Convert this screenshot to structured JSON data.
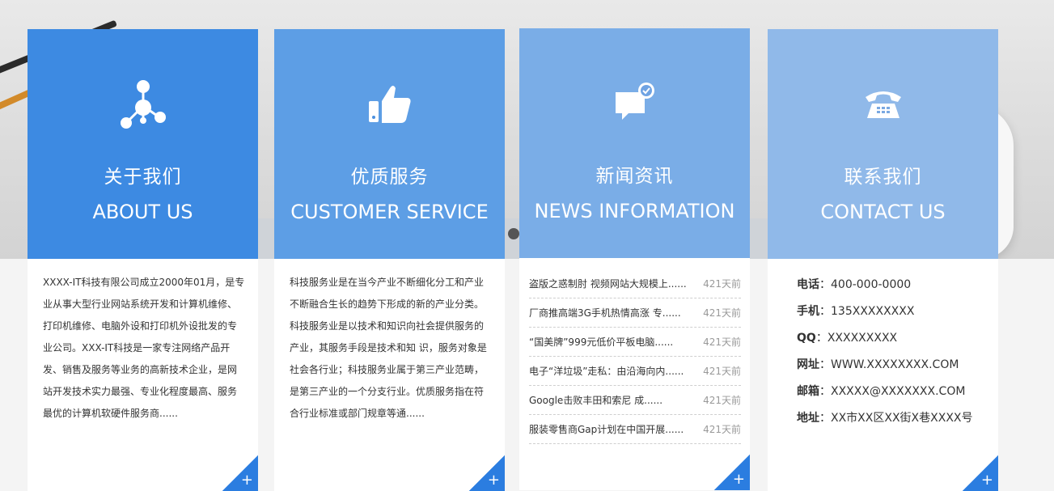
{
  "cards": [
    {
      "icon": "molecule-network-icon",
      "title_cn": "关于我们",
      "title_en": "ABOUT US",
      "text": "XXXX-IT科技有限公司成立2000年01月，是专业从事大型行业网站系统开发和计算机维修、打印机维修、电脑外设和打印机外设批发的专业公司。XXX-IT科技是一家专注网络产品开发、销售及服务等业务的高新技术企业，是网站开发技术实力最强、专业化程度最高、服务最优的计算机软硬件服务商......"
    },
    {
      "icon": "thumbs-up-icon",
      "title_cn": "优质服务",
      "title_en": "CUSTOMER SERVICE",
      "text": " 科技服务业是在当今产业不断细化分工和产业不断融合生长的趋势下形成的新的产业分类。科技服务业是以技术和知识向社会提供服务的产业，其服务手段是技术和知 识，服务对象是社会各行业；科技服务业属于第三产业范畴，是第三产业的一个分支行业。优质服务指在符合行业标准或部门规章等通......"
    },
    {
      "icon": "chat-check-icon",
      "title_cn": "新闻资讯",
      "title_en": "NEWS INFORMATION",
      "news": [
        {
          "title": "盗版之惑制肘 视频网站大规模上......",
          "date": "421天前"
        },
        {
          "title": "厂商推高端3G手机热情高涨 专......",
          "date": "421天前"
        },
        {
          "title": "“国美牌”999元低价平板电脑......",
          "date": "421天前"
        },
        {
          "title": "电子“洋垃圾”走私：由沿海向内......",
          "date": "421天前"
        },
        {
          "title": "Google击败丰田和索尼 成......",
          "date": "421天前"
        },
        {
          "title": "服装零售商Gap计划在中国开展......",
          "date": "421天前"
        }
      ]
    },
    {
      "icon": "telephone-icon",
      "title_cn": "联系我们",
      "title_en": "CONTACT US",
      "contacts": [
        {
          "label": "电话",
          "value": "400-000-0000"
        },
        {
          "label": "手机",
          "value": "135XXXXXXXX"
        },
        {
          "label": "QQ",
          "value": "XXXXXXXXX"
        },
        {
          "label": "网址",
          "value": "WWW.XXXXXXXX.COM"
        },
        {
          "label": "邮箱",
          "value": "XXXXX@XXXXXXX.COM"
        },
        {
          "label": "地址",
          "value": "XX市XX区XX街X巷XXXX号"
        }
      ]
    }
  ],
  "separator": "：",
  "more_symbol": "+"
}
